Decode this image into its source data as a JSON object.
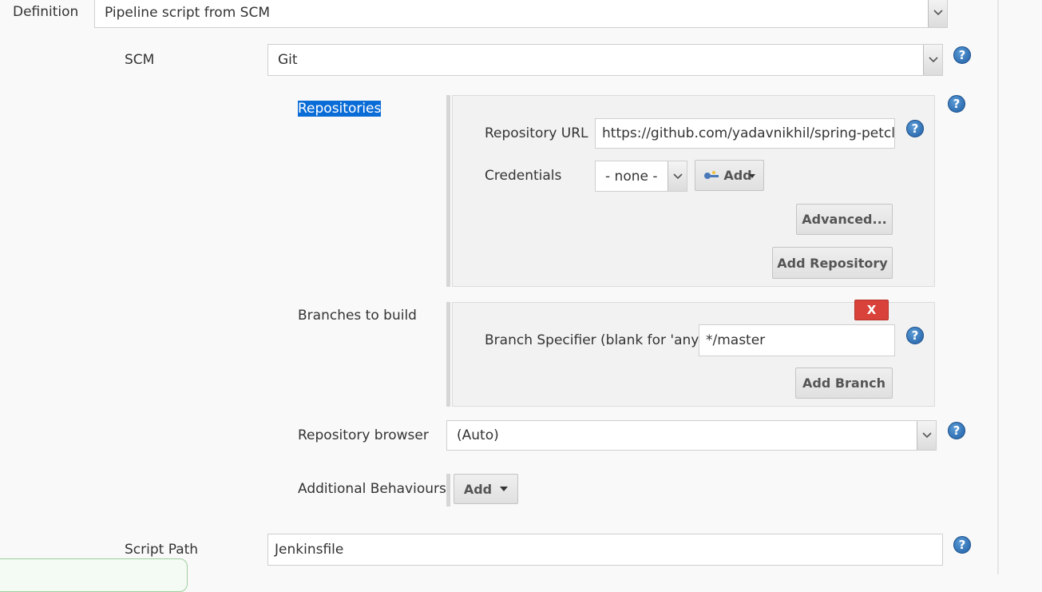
{
  "definition": {
    "label": "Definition",
    "value": "Pipeline script from SCM"
  },
  "scm": {
    "label": "SCM",
    "value": "Git"
  },
  "repositories": {
    "label": "Repositories",
    "url_label": "Repository URL",
    "url_value": "https://github.com/yadavnikhil/spring-petclinic.",
    "credentials_label": "Credentials",
    "credentials_value": "- none -",
    "add_label": "Add",
    "advanced_label": "Advanced...",
    "add_repository_label": "Add Repository"
  },
  "branches": {
    "label": "Branches to build",
    "remove_label": "X",
    "specifier_label": "Branch Specifier (blank for 'any')",
    "specifier_value": "*/master",
    "add_branch_label": "Add Branch"
  },
  "repo_browser": {
    "label": "Repository browser",
    "value": "(Auto)"
  },
  "behaviours": {
    "label": "Additional Behaviours",
    "add_label": "Add"
  },
  "script_path": {
    "label": "Script Path",
    "value": "Jenkinsfile"
  },
  "help_glyph": "?",
  "colors": {
    "help": "#1f5fa6",
    "remove": "#d9423a",
    "selection": "#0a6cd6"
  }
}
